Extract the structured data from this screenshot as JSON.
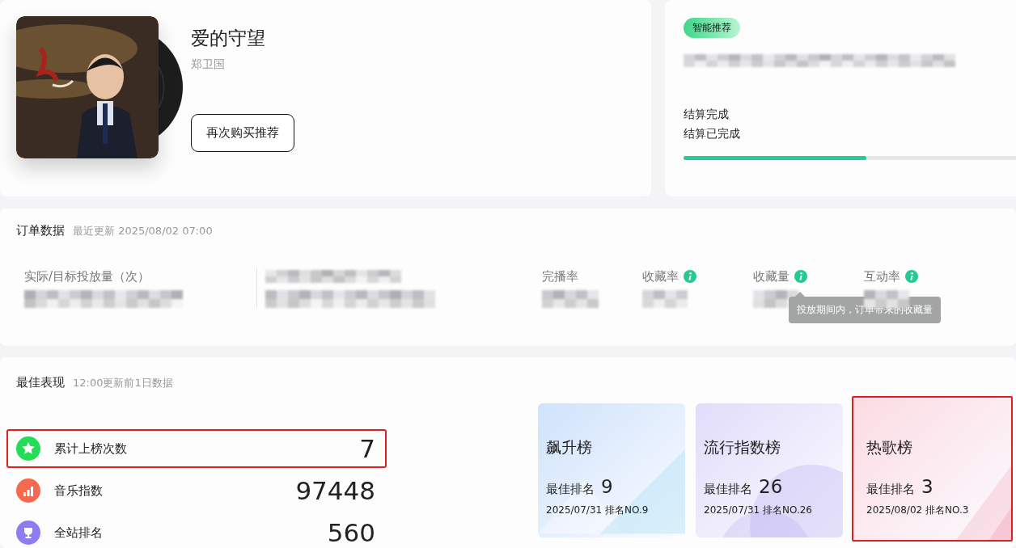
{
  "song": {
    "title": "爱的守望",
    "artist": "郑卫国",
    "button": "再次购买推荐"
  },
  "settlement": {
    "badge": "智能推荐",
    "status": "结算完成",
    "detail": "结算已完成",
    "progress": {
      "level": 0.55
    }
  },
  "order": {
    "title": "订单数据",
    "updated": "最近更新 2025/08/02 07:00",
    "metrics": [
      {
        "label": "实际/目标投放量（次）",
        "info": false
      },
      {
        "info": false
      },
      {
        "label": "完播率",
        "info": false
      },
      {
        "label": "收藏率",
        "info": true
      },
      {
        "label": "收藏量",
        "info": true,
        "tooltip": "投放期间内，订单带来的收藏量"
      },
      {
        "label": "互动率",
        "info": true
      }
    ]
  },
  "best": {
    "title": "最佳表现",
    "note": "12:00更新前1日数据",
    "stats": [
      {
        "kind": "star",
        "label": "累计上榜次数",
        "value": "7",
        "color": "#22dd55",
        "highlighted": true
      },
      {
        "kind": "bars",
        "label": "音乐指数",
        "value": "97448",
        "color": "#f56a4f",
        "highlighted": false
      },
      {
        "kind": "trophy",
        "label": "全站排名",
        "value": "560",
        "color": "#8e7cf0",
        "highlighted": false
      }
    ],
    "charts": [
      {
        "name": "飙升榜",
        "rank_label": "最佳排名",
        "rank": "9",
        "date": "2025/07/31 排名NO.9",
        "color": "#cfe3fb",
        "highlighted": false
      },
      {
        "name": "流行指数榜",
        "rank_label": "最佳排名",
        "rank": "26",
        "date": "2025/07/31 排名NO.26",
        "color": "#e2dcfa",
        "highlighted": false
      },
      {
        "name": "热歌榜",
        "rank_label": "最佳排名",
        "rank": "3",
        "date": "2025/08/02 排名NO.3",
        "color": "#fcdbe3",
        "highlighted": true
      }
    ]
  }
}
